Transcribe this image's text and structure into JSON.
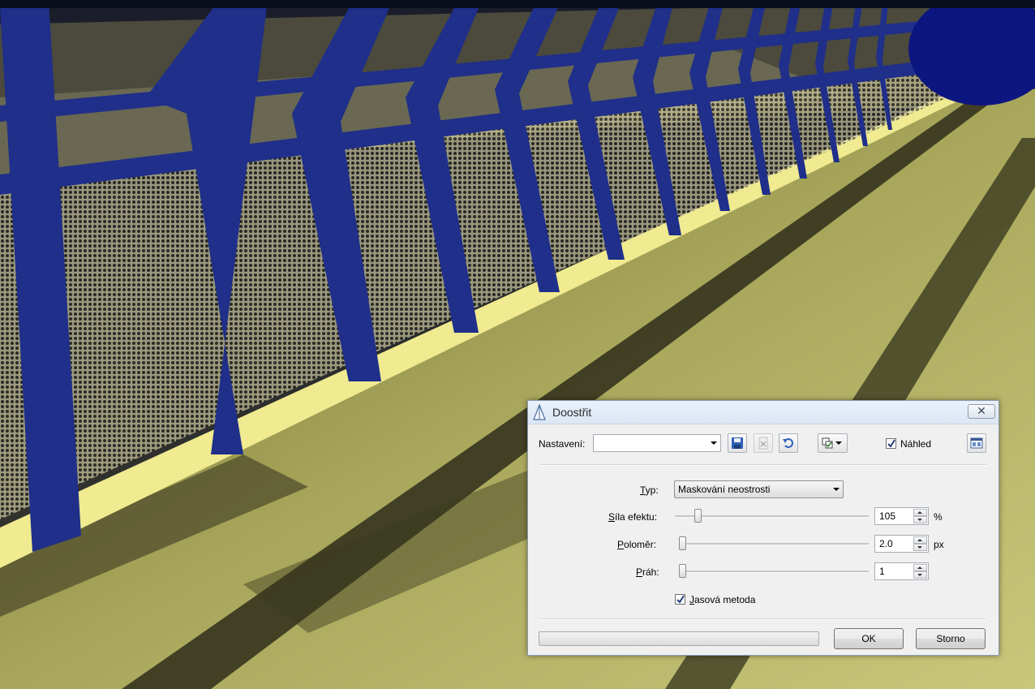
{
  "dialog": {
    "title": "Doostřit",
    "close_symbol": "✕",
    "title_icon": "sharpen-triangle-icon",
    "settings": {
      "label_prefix": "Nastavení:",
      "preset_value": "",
      "buttons": [
        "save-preset-icon",
        "delete-preset-icon",
        "reset-icon",
        "options-dropdown-icon"
      ]
    },
    "preview": {
      "label": "Náhled",
      "checked": true
    },
    "layout_button_icon": "split-view-icon",
    "type": {
      "label_u": "T",
      "label_rest": "yp:",
      "value": "Maskování neostrosti"
    },
    "strength": {
      "label_u": "S",
      "label_rest": "íla efektu:",
      "value": "105",
      "unit": "%",
      "slider_fraction": 0.105
    },
    "radius": {
      "label_u": "P",
      "label_rest": "oloměr:",
      "value": "2.0",
      "unit": "px",
      "slider_fraction": 0.0
    },
    "threshold": {
      "label_u": "P",
      "label_rest": "ráh:",
      "value": "1",
      "unit": "",
      "slider_fraction": 0.0
    },
    "luminance": {
      "label_u": "J",
      "label_rest": "asová metoda",
      "checked": true
    },
    "progress_fraction": 0,
    "ok_label": "OK",
    "cancel_label": "Storno"
  },
  "colors": {
    "rail_blue": "#1f2f8a",
    "floor_yellow": "#b6b560",
    "night_dark": "#0b0e1c"
  }
}
